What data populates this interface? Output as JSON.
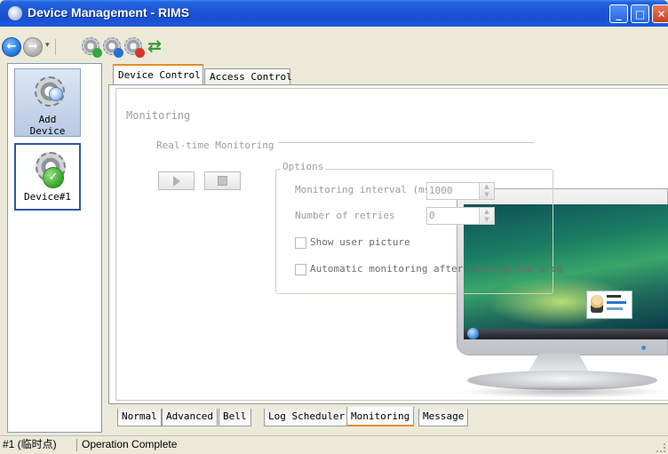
{
  "window": {
    "title": "Device Management - RIMS",
    "minimize": "_",
    "maximize": "□",
    "close": "✕"
  },
  "toolbar": {
    "back_glyph": "←",
    "forward_glyph": "→",
    "dropdown_glyph": "▾",
    "refresh_glyph": "⇄"
  },
  "devices": [
    {
      "label_line1": "Add",
      "label_line2": "Device"
    },
    {
      "label": "Device#1"
    }
  ],
  "top_tabs": [
    {
      "label": "Device Control",
      "active": true
    },
    {
      "label": "Access Control",
      "active": false
    }
  ],
  "monitoring": {
    "title": "Monitoring",
    "realtime_label": "Real-time Monitoring",
    "options_legend": "Options",
    "interval_label": "Monitoring interval (ms",
    "interval_value": "1000",
    "retries_label": "Number of retries",
    "retries_value": "0",
    "show_picture_label": "Show user picture",
    "auto_monitor_label": "Automatic monitoring after running the prog",
    "spin_up": "▲",
    "spin_down": "▼"
  },
  "bottom_tabs": [
    {
      "label": "Normal"
    },
    {
      "label": "Advanced"
    },
    {
      "label": "Bell"
    },
    {
      "label": "Log Scheduler"
    },
    {
      "label": "Monitoring",
      "active": true
    },
    {
      "label": "Message"
    }
  ],
  "status": {
    "device": "#1 (临时点)",
    "message": "Operation Complete"
  },
  "colors": {
    "title_bar": "#1E55D8",
    "active_tab_accent": "#E68B2C",
    "selected_device_border": "#2E57A8",
    "window_bg": "#ECE9D8"
  }
}
